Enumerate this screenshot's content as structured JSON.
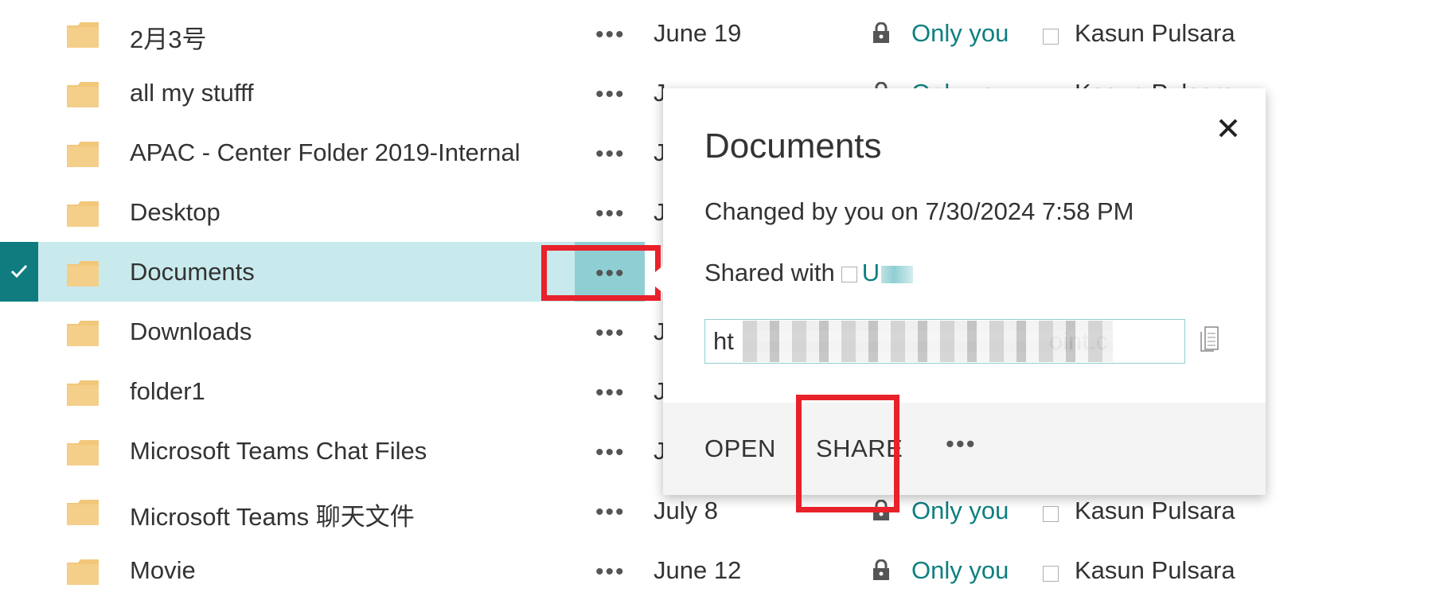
{
  "rows": [
    {
      "name": "2月3号",
      "date": "June 19",
      "sharing": "Only you",
      "modified_by": "Kasun Pulsara"
    },
    {
      "name": "all my stufff",
      "date": "J",
      "sharing": "Only you",
      "modified_by": "Kasun Pulsara"
    },
    {
      "name": "APAC - Center Folder 2019-Internal",
      "date": "J",
      "sharing": "",
      "modified_by": ""
    },
    {
      "name": "Desktop",
      "date": "J",
      "sharing": "",
      "modified_by": ""
    },
    {
      "name": "Documents",
      "date": "",
      "sharing": "",
      "modified_by": ""
    },
    {
      "name": "Downloads",
      "date": "J",
      "sharing": "",
      "modified_by": ""
    },
    {
      "name": "folder1",
      "date": "J",
      "sharing": "",
      "modified_by": ""
    },
    {
      "name": "Microsoft Teams Chat Files",
      "date": "J",
      "sharing": "",
      "modified_by": ""
    },
    {
      "name": "Microsoft Teams 聊天文件",
      "date": "July 8",
      "sharing": "Only you",
      "modified_by": "Kasun Pulsara"
    },
    {
      "name": "Movie",
      "date": "June 12",
      "sharing": "Only you",
      "modified_by": "Kasun Pulsara"
    }
  ],
  "row_ellipsis": "•••",
  "selected_row_index": 4,
  "callout": {
    "title": "Documents",
    "changed": "Changed by you on 7/30/2024 7:58 PM",
    "shared_label": "Shared with",
    "shared_user": "U",
    "link_value": "ht                                              oint.c",
    "open_label": "OPEN",
    "share_label": "SHARE",
    "more_label": "•••"
  },
  "icons": {
    "folder": "folder-icon",
    "lock": "lock-icon",
    "close": "close-icon",
    "copy": "copy-icon",
    "check": "checkmark-icon"
  },
  "colors": {
    "accent_teal": "#0e7f80",
    "selected_row": "#c8eaed",
    "selected_dots_cell": "#8fcfd3",
    "highlight_red": "#e8212a",
    "folder_yellow": "#f2c77a"
  }
}
